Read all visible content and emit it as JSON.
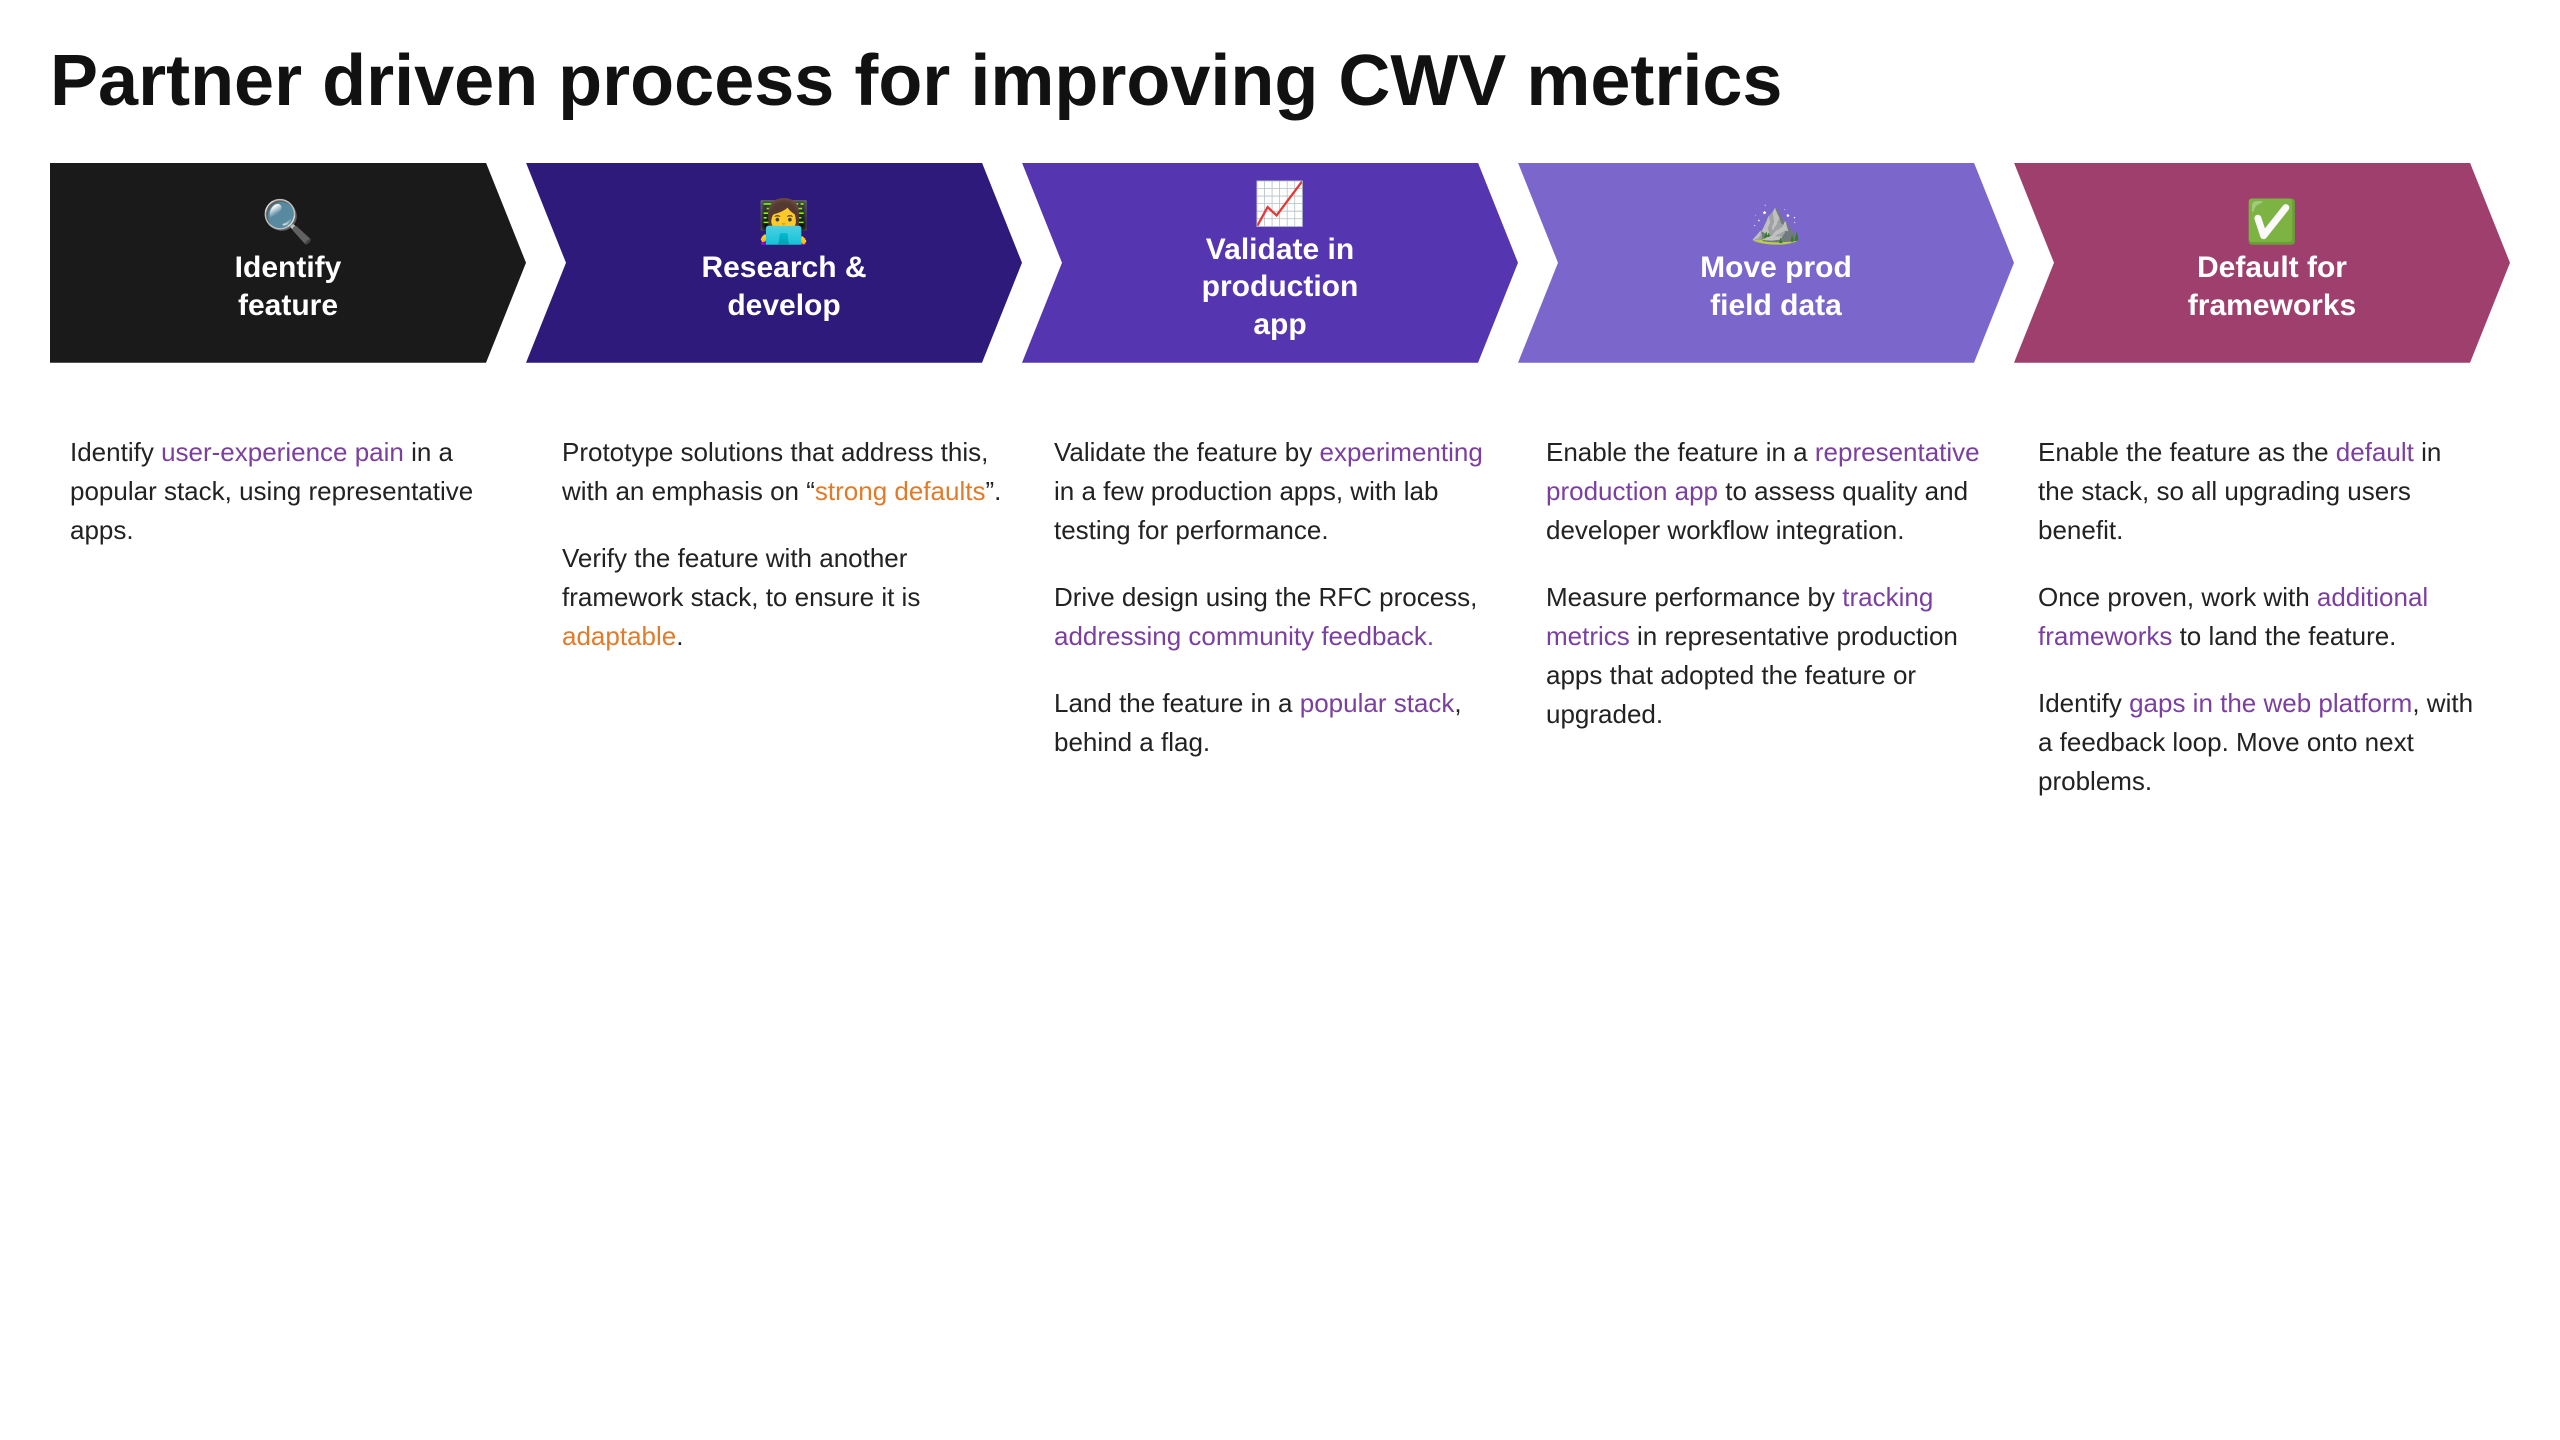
{
  "page": {
    "title": "Partner driven process for improving CWV metrics"
  },
  "steps": [
    {
      "id": "identify",
      "icon": "🔍",
      "label": "Identify\nfeature",
      "color": "#1a1a1a",
      "content": []
    },
    {
      "id": "research",
      "icon": "👩‍💻",
      "label": "Research &\ndevelop",
      "color": "#2e1a7a",
      "content": []
    },
    {
      "id": "validate",
      "icon": "📈",
      "label": "Validate in\nproduction\napp",
      "color": "#5535b0",
      "content": []
    },
    {
      "id": "move",
      "icon": "⛰️",
      "label": "Move prod\nfield data",
      "color": "#7b66cc",
      "content": []
    },
    {
      "id": "default",
      "icon": "✅",
      "label": "Default for\nframeworks",
      "color": "#9e3f6e",
      "content": []
    }
  ],
  "columns": [
    {
      "paragraphs": [
        {
          "parts": [
            {
              "text": "Identify ",
              "style": "normal"
            },
            {
              "text": "user-experience pain",
              "style": "link-purple"
            },
            {
              "text": " in a popular stack, using representative apps.",
              "style": "normal"
            }
          ]
        }
      ]
    },
    {
      "paragraphs": [
        {
          "parts": [
            {
              "text": "Prototype solutions that address this, with an emphasis on “",
              "style": "normal"
            },
            {
              "text": "strong defaults",
              "style": "link-orange"
            },
            {
              "text": "”.",
              "style": "normal"
            }
          ]
        },
        {
          "parts": [
            {
              "text": "Verify the feature with another framework stack, to ensure it is ",
              "style": "normal"
            },
            {
              "text": "adaptable",
              "style": "link-orange"
            },
            {
              "text": ".",
              "style": "normal"
            }
          ]
        }
      ]
    },
    {
      "paragraphs": [
        {
          "parts": [
            {
              "text": "Validate the feature by ",
              "style": "normal"
            },
            {
              "text": "experimenting",
              "style": "link-purple"
            },
            {
              "text": " in a few production apps, with lab testing for performance.",
              "style": "normal"
            }
          ]
        },
        {
          "parts": [
            {
              "text": "Drive design using the RFC process, ",
              "style": "normal"
            },
            {
              "text": "addressing community feedback.",
              "style": "link-purple"
            }
          ]
        },
        {
          "parts": [
            {
              "text": "Land the feature in a ",
              "style": "normal"
            },
            {
              "text": "popular stack",
              "style": "link-purple"
            },
            {
              "text": ", behind a flag.",
              "style": "normal"
            }
          ]
        }
      ]
    },
    {
      "paragraphs": [
        {
          "parts": [
            {
              "text": "Enable the feature in a ",
              "style": "normal"
            },
            {
              "text": "representative production app",
              "style": "link-purple"
            },
            {
              "text": " to assess quality and developer workflow integration.",
              "style": "normal"
            }
          ]
        },
        {
          "parts": [
            {
              "text": "Measure performance by ",
              "style": "normal"
            },
            {
              "text": "tracking metrics",
              "style": "link-purple"
            },
            {
              "text": " in representative production apps that adopted the feature or upgraded.",
              "style": "normal"
            }
          ]
        }
      ]
    },
    {
      "paragraphs": [
        {
          "parts": [
            {
              "text": "Enable the feature as the ",
              "style": "normal"
            },
            {
              "text": "default",
              "style": "link-purple"
            },
            {
              "text": " in the stack, so all upgrading users benefit.",
              "style": "normal"
            }
          ]
        },
        {
          "parts": [
            {
              "text": "Once proven, work with ",
              "style": "normal"
            },
            {
              "text": "additional frameworks",
              "style": "link-purple"
            },
            {
              "text": " to land the feature.",
              "style": "normal"
            }
          ]
        },
        {
          "parts": [
            {
              "text": "Identify ",
              "style": "normal"
            },
            {
              "text": "gaps in the web platform",
              "style": "link-purple"
            },
            {
              "text": ", with a feedback loop. Move onto next problems.",
              "style": "normal"
            }
          ]
        }
      ]
    }
  ]
}
